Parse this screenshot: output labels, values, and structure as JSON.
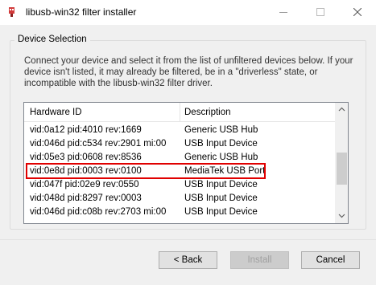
{
  "window": {
    "title": "libusb-win32 filter installer"
  },
  "group": {
    "legend": "Device Selection",
    "instructions": "Connect your device and select it from the list of unfiltered devices below. If your device isn't listed, it may already be filtered, be in a \"driverless\" state, or incompatible with the libusb-win32 filter driver."
  },
  "device_list": {
    "columns": [
      "Hardware ID",
      "Description"
    ],
    "rows": [
      {
        "hardware_id": "vid:0a12 pid:4010 rev:1669",
        "description": "Generic USB Hub"
      },
      {
        "hardware_id": "vid:046d pid:c534 rev:2901 mi:00",
        "description": "USB Input Device"
      },
      {
        "hardware_id": "vid:05e3 pid:0608 rev:8536",
        "description": "Generic USB Hub"
      },
      {
        "hardware_id": "vid:0e8d pid:0003 rev:0100",
        "description": "MediaTek USB Port"
      },
      {
        "hardware_id": "vid:047f pid:02e9 rev:0550",
        "description": "USB Input Device"
      },
      {
        "hardware_id": "vid:048d pid:8297 rev:0003",
        "description": "USB Input Device"
      },
      {
        "hardware_id": "vid:046d pid:c08b rev:2703 mi:00",
        "description": "USB Input Device"
      }
    ],
    "highlighted_row_index": 3
  },
  "buttons": {
    "back": "< Back",
    "install": "Install",
    "cancel": "Cancel"
  },
  "colors": {
    "highlight_border": "#e00000",
    "disabled_text": "#a0a0a0"
  }
}
